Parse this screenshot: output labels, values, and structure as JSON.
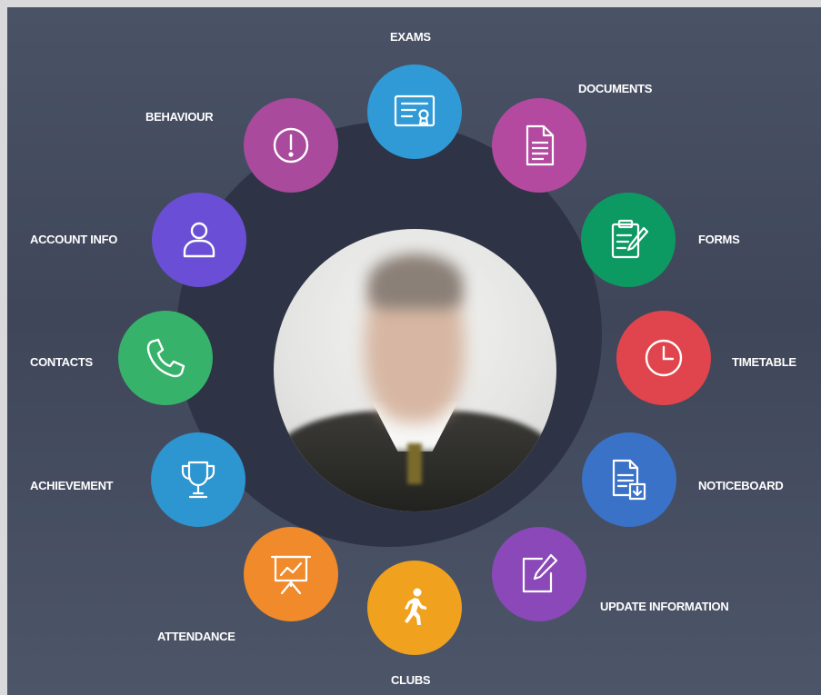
{
  "menu": {
    "exams": {
      "label": "EXAMS",
      "icon": "certificate-icon",
      "color": "#2f9ad6"
    },
    "documents": {
      "label": "DOCUMENTS",
      "icon": "document-icon",
      "color": "#b44aa0"
    },
    "forms": {
      "label": "FORMS",
      "icon": "form-edit-icon",
      "color": "#0d9a62"
    },
    "timetable": {
      "label": "TIMETABLE",
      "icon": "clock-icon",
      "color": "#e0454d"
    },
    "noticeboard": {
      "label": "NOTICEBOARD",
      "icon": "notice-download-icon",
      "color": "#3a72c8"
    },
    "update_information": {
      "label": "UPDATE INFORMATION",
      "icon": "edit-note-icon",
      "color": "#8a48b8"
    },
    "clubs": {
      "label": "CLUBS",
      "icon": "running-person-icon",
      "color": "#f0a21e"
    },
    "attendance": {
      "label": "ATTENDANCE",
      "icon": "presentation-chart-icon",
      "color": "#f08a2a"
    },
    "achievement": {
      "label": "ACHIEVEMENT",
      "icon": "trophy-icon",
      "color": "#2d95cf"
    },
    "contacts": {
      "label": "CONTACTS",
      "icon": "phone-icon",
      "color": "#36b26a"
    },
    "account_info": {
      "label": "ACCOUNT INFO",
      "icon": "user-icon",
      "color": "#6a4fd6"
    },
    "behaviour": {
      "label": "BEHAVIOUR",
      "icon": "exclamation-icon",
      "color": "#a94a9c"
    }
  },
  "profile": {
    "photo": "profile-photo"
  }
}
